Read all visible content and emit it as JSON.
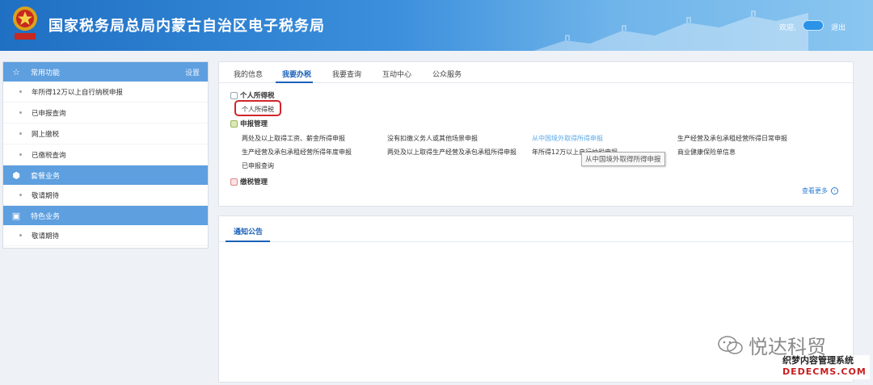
{
  "header": {
    "title": "国家税务局总局内蒙古自治区电子税务局",
    "welcome": "欢迎,",
    "logout": "退出",
    "emblem_text": "中国税务"
  },
  "sidebar": {
    "sections": [
      {
        "icon": "star-icon",
        "title": "常用功能",
        "action": "设置",
        "items": [
          "年所得12万以上自行纳税申报",
          "已申报查询",
          "网上缴税",
          "已缴税查询"
        ]
      },
      {
        "icon": "package-icon",
        "title": "套餐业务",
        "action": "",
        "items": [
          "敬请期待"
        ]
      },
      {
        "icon": "special-icon",
        "title": "特色业务",
        "action": "",
        "items": [
          "敬请期待"
        ]
      }
    ]
  },
  "main": {
    "tabs": [
      "我的信息",
      "我要办税",
      "我要查询",
      "互动中心",
      "公众服务"
    ],
    "active_tab": "我要办税",
    "category_title": "个人所得税",
    "category_item": "个人所得税",
    "sections": [
      {
        "title": "申报管理",
        "links": [
          "两处及以上取得工资、薪金所得申报",
          "没有扣缴义务人或其他场景申报",
          "从中国境外取得所得申报",
          "生产经营及承包承租经营所得日常申报",
          "生产经营及承包承租经营所得年度申报",
          "两处及以上取得生产经营及承包承租所得申报",
          "年所得12万以上自行纳税申报",
          "商业健康保险单信息",
          "已申报查询"
        ]
      },
      {
        "title": "缴税管理",
        "links": []
      }
    ],
    "tooltip": "从中国境外取得所得申报",
    "more": "查看更多"
  },
  "notice": {
    "tab": "通知公告"
  },
  "watermark": {
    "brand": "悦达科贸",
    "line1": "织梦内容管理系统",
    "line2": "DEDECMS.COM"
  },
  "colors": {
    "header_blue": "#1f6fc3",
    "sidebar_head": "#5d9fdf",
    "active_tab": "#1b61b8",
    "link_highlight": "#5aa9e8",
    "annotation_red": "#d1262b"
  }
}
